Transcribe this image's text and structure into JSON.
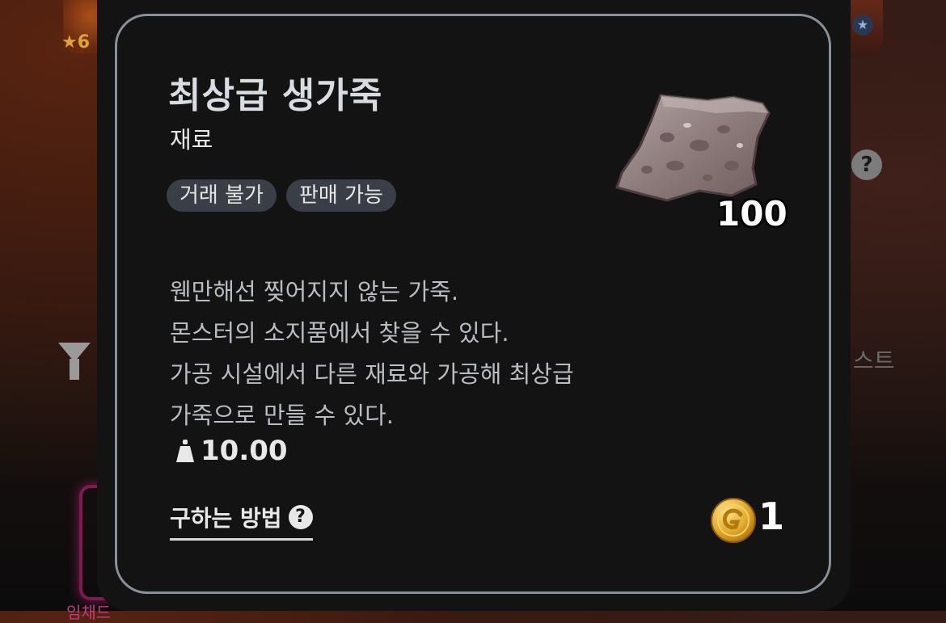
{
  "background": {
    "top_left_rating": "★6",
    "right_list_text": "스트",
    "bottom_left_text": "임채드"
  },
  "item": {
    "name": "최상급 생가죽",
    "category": "재료",
    "tags": [
      "거래 불가",
      "판매 가능"
    ],
    "quantity": "100",
    "description": [
      "웬만해선 찢어지지 않는 가죽.",
      "몬스터의 소지품에서 찾을 수 있다.",
      "가공 시설에서 다른 재료와 가공해 최상급",
      "가죽으로 만들 수 있다."
    ],
    "weight": "10.00",
    "how_to_obtain_label": "구하는 방법",
    "price": "1"
  },
  "colors": {
    "popup_bg": "#131313",
    "frame_border": "#8a9099",
    "tag_bg": "#3a3e46",
    "coin_gold": "#e0a92a",
    "hide_color": "#8e7c7c"
  },
  "icons": {
    "weight": "weight-icon",
    "help": "question-circle-icon",
    "coin": "gold-coin-icon",
    "item": "leather-hide-icon"
  }
}
